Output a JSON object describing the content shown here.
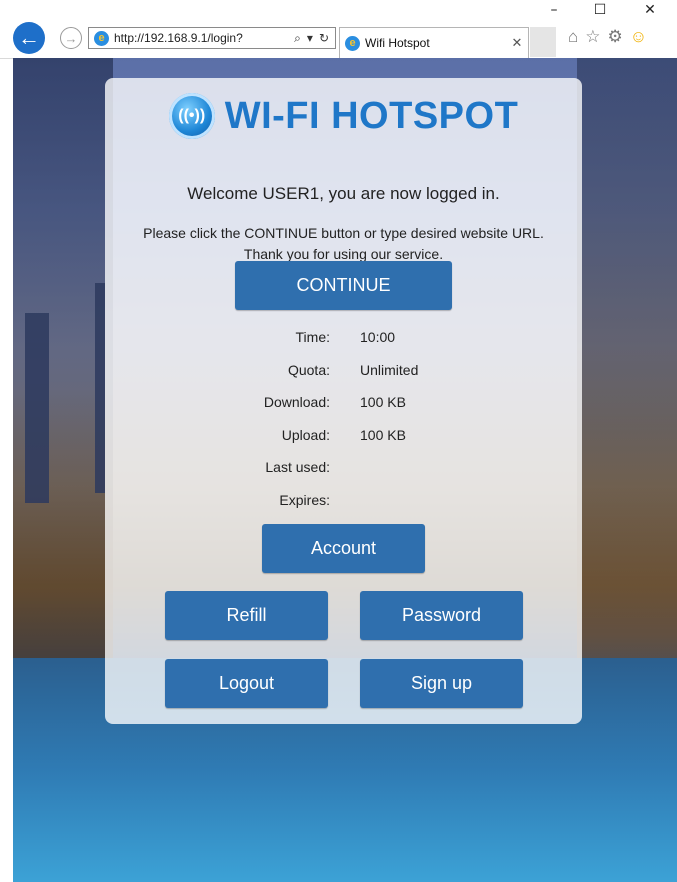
{
  "browser": {
    "window_controls": {
      "minimize": "–",
      "maximize": "☐",
      "close": "✕"
    },
    "address": "http://192.168.9.1/login?",
    "address_tools": {
      "search": "⌕",
      "dropdown": "▾",
      "refresh": "↻"
    },
    "tab_title": "Wifi Hotspot",
    "tab_close": "✕",
    "icons": [
      "back-icon",
      "forward-icon",
      "ie-icon",
      "home-icon",
      "favorites-star-icon",
      "settings-gear-icon",
      "smiley-icon"
    ]
  },
  "page": {
    "logo_text": "WI-FI HOTSPOT",
    "welcome": "Welcome USER1, you are now logged in.",
    "instruction_line1": "Please click the CONTINUE button or type desired website URL.",
    "instruction_line2": "Thank you for using our service.",
    "continue_label": "CONTINUE",
    "stats": [
      {
        "label": "Time:",
        "value": "10:00"
      },
      {
        "label": "Quota:",
        "value": "Unlimited"
      },
      {
        "label": "Download:",
        "value": "100 KB"
      },
      {
        "label": "Upload:",
        "value": "100 KB"
      },
      {
        "label": "Last used:",
        "value": ""
      },
      {
        "label": "Expires:",
        "value": ""
      }
    ],
    "account_label": "Account",
    "refill_label": "Refill",
    "password_label": "Password",
    "logout_label": "Logout",
    "signup_label": "Sign up"
  },
  "colors": {
    "button_bg": "#2f6fae",
    "logo_blue": "#1f77c8",
    "back_button": "#1e6fc9"
  }
}
